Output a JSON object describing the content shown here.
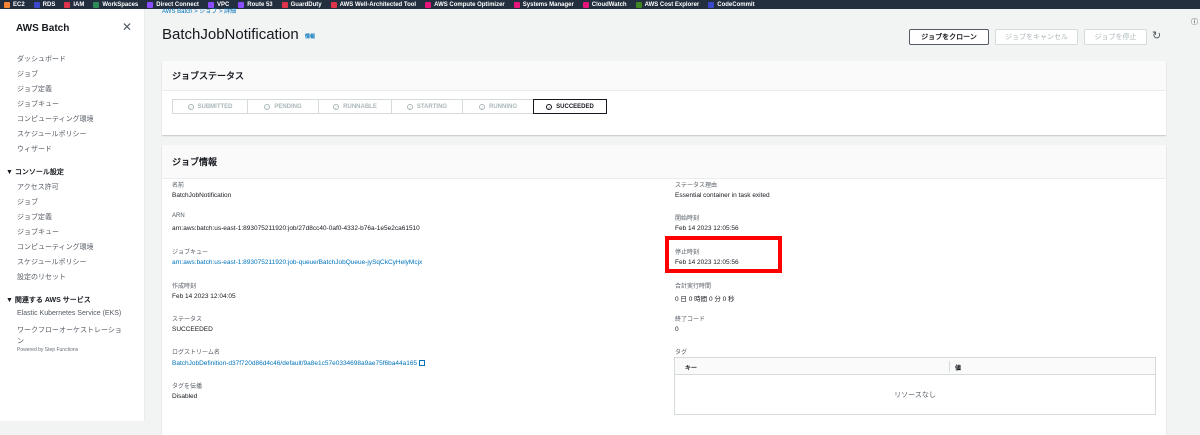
{
  "bookmarks": [
    {
      "label": "EC2",
      "color": "#f58534"
    },
    {
      "label": "RDS",
      "color": "#3b48cc"
    },
    {
      "label": "IAM",
      "color": "#dd344c"
    },
    {
      "label": "WorkSpaces",
      "color": "#2e8b57"
    },
    {
      "label": "Direct Connect",
      "color": "#8c4fff"
    },
    {
      "label": "VPC",
      "color": "#8c4fff"
    },
    {
      "label": "Route 53",
      "color": "#8c4fff"
    },
    {
      "label": "GuardDuty",
      "color": "#dd344c"
    },
    {
      "label": "AWS Well-Architected Tool",
      "color": "#dd344c"
    },
    {
      "label": "AWS Compute Optimizer",
      "color": "#e7157b"
    },
    {
      "label": "Systems Manager",
      "color": "#e7157b"
    },
    {
      "label": "CloudWatch",
      "color": "#e7157b"
    },
    {
      "label": "AWS Cost Explorer",
      "color": "#3f8624"
    },
    {
      "label": "CodeCommit",
      "color": "#3b48cc"
    }
  ],
  "sidebar": {
    "title": "AWS Batch",
    "items": [
      "ダッシュボード",
      "ジョブ",
      "ジョブ定義",
      "ジョブキュー",
      "コンピューティング環境",
      "スケジュールポリシー",
      "ウィザード"
    ],
    "console_section": "▼ コンソール設定",
    "console_items": [
      "アクセス許可",
      "ジョブ",
      "ジョブ定義",
      "ジョブキュー",
      "コンピューティング環境",
      "スケジュールポリシー",
      "設定のリセット"
    ],
    "related_section": "▼ 関連する AWS サービス",
    "related_items": [
      "Elastic Kubernetes Service (EKS)",
      "ワークフローオーケストレーショ",
      "ン"
    ],
    "powered_by": "Powered by Step Functions"
  },
  "header": {
    "breadcrumb": "AWS Batch  >  ジョブ  >  詳細",
    "title": "BatchJobNotification",
    "info": "情報",
    "clone_button": "ジョブをクローン",
    "cancel_button": "ジョブをキャンセル",
    "terminate_button": "ジョブを停止"
  },
  "status_panel": {
    "title": "ジョブステータス",
    "steps": [
      "SUBMITTED",
      "PENDING",
      "RUNNABLE",
      "STARTING",
      "RUNNING",
      "SUCCEEDED"
    ],
    "active_step": "SUCCEEDED"
  },
  "info_panel": {
    "title": "ジョブ情報",
    "left": {
      "name_label": "名前",
      "name_value": "BatchJobNotification",
      "arn_label": "ARN",
      "arn_value": "arn:aws:batch:us-east-1:893075211920:job/27d8cc40-0af0-4332-b76a-1e5e2ca61510",
      "queue_label": "ジョブキュー",
      "queue_value": "arn:aws:batch:us-east-1:893075211920:job-queue/BatchJobQueue-jySqCkCyHelyMcjx",
      "created_label": "作成時刻",
      "created_value": "Feb 14 2023 12:04:05",
      "status_label": "ステータス",
      "status_value": "SUCCEEDED",
      "log_label": "ログストリーム名",
      "log_value": "BatchJobDefinition-d37f720d86d4c46/default/9a8e1c57e0334698a9ae75f6ba44a165",
      "propagate_label": "タグを伝播",
      "propagate_value": "Disabled"
    },
    "right": {
      "reason_label": "ステータス理由",
      "reason_value": "Essential container in task exited",
      "start_label": "開始時刻",
      "start_value": "Feb 14 2023 12:05:56",
      "stop_label": "停止時刻",
      "stop_value": "Feb 14 2023 12:05:56",
      "total_label": "合計実行時間",
      "total_value": "0 日 0 時間 0 分 0 秒",
      "exit_label": "終了コード",
      "exit_value": "0",
      "tags_label": "タグ",
      "tags_key_col": "キー",
      "tags_value_col": "値",
      "tags_empty": "リソースなし"
    }
  }
}
